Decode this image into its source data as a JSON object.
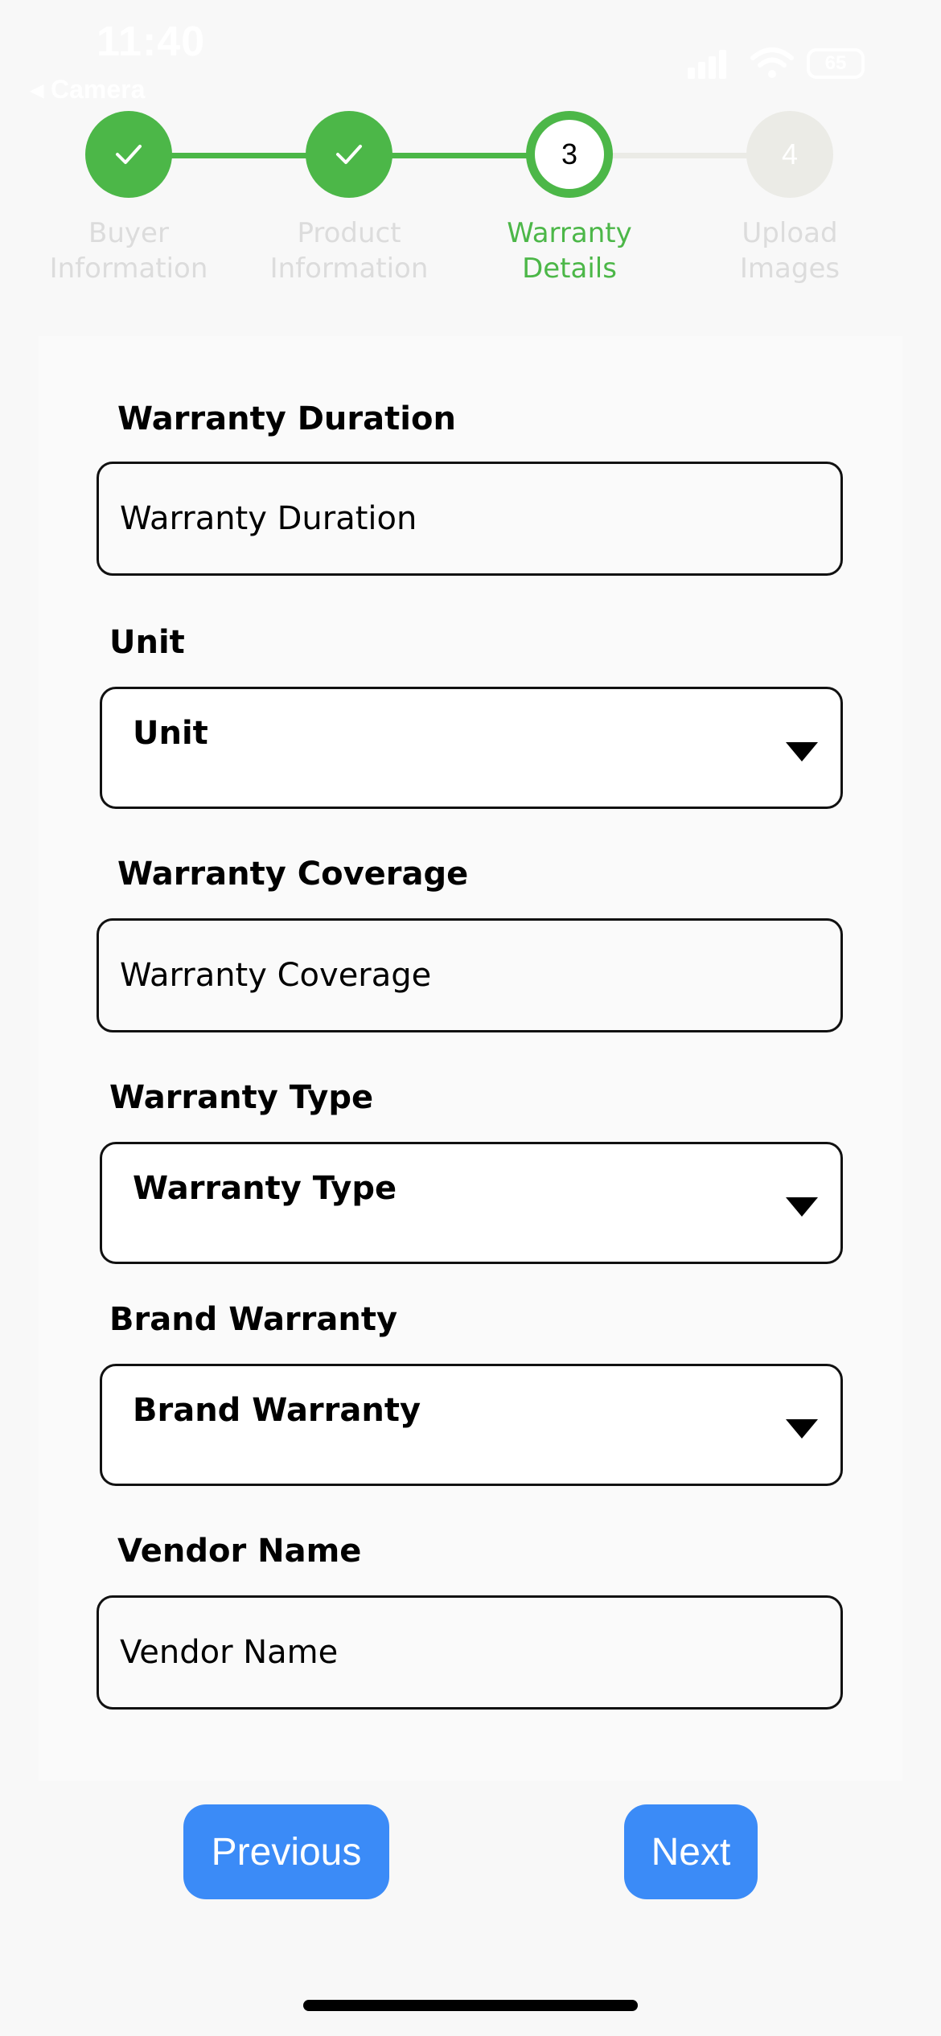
{
  "status_bar": {
    "time": "11:40",
    "back_label": "◂ Camera",
    "battery_level": "65"
  },
  "stepper": {
    "steps": [
      {
        "label": "Buyer\nInformation",
        "state": "done",
        "number": "1"
      },
      {
        "label": "Product\nInformation",
        "state": "done",
        "number": "2"
      },
      {
        "label": "Warranty\nDetails",
        "state": "current",
        "number": "3"
      },
      {
        "label": "Upload\nImages",
        "state": "upcoming",
        "number": "4"
      }
    ],
    "colors": {
      "done": "#4cb748",
      "pending": "#ebebe6"
    }
  },
  "form": {
    "warranty_duration": {
      "label": "Warranty Duration",
      "placeholder": "Warranty Duration",
      "value": ""
    },
    "unit": {
      "label": "Unit",
      "selected": "Unit"
    },
    "warranty_coverage": {
      "label": "Warranty Coverage",
      "placeholder": "Warranty Coverage",
      "value": ""
    },
    "warranty_type": {
      "label": "Warranty Type",
      "selected": "Warranty Type"
    },
    "brand_warranty": {
      "label": "Brand Warranty",
      "selected": "Brand Warranty"
    },
    "vendor_name": {
      "label": "Vendor Name",
      "placeholder": "Vendor Name",
      "value": ""
    }
  },
  "buttons": {
    "previous": "Previous",
    "next": "Next",
    "color": "#3b8bf7"
  },
  "icons": {
    "check": "check-icon",
    "dropdown": "chevron-down-icon"
  }
}
